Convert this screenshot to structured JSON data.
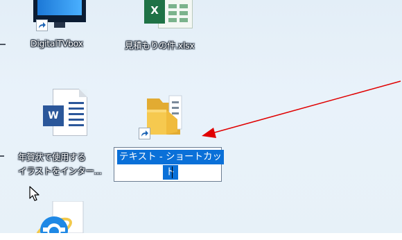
{
  "desktop": {
    "background_color": "#e7f1f8",
    "items": [
      {
        "label": "DigitalTVbox",
        "icon": "tv-icon",
        "shortcut": true
      },
      {
        "label": "見積もりの件.xlsx",
        "icon": "excel-icon",
        "shortcut": false
      },
      {
        "label_line1": "年賀状で使用する",
        "label_line2": "イラストをインター...",
        "icon": "word-doc-icon",
        "shortcut": false
      },
      {
        "icon": "folder-icon",
        "shortcut": true
      }
    ],
    "rename_box": {
      "line1": "テキスト - ショートカッ",
      "line2": "ト"
    },
    "bottom_icon": "internet-explorer-icon"
  },
  "annotation": {
    "arrow_color": "#e00000"
  },
  "colors": {
    "selection": "#0a70d8",
    "word": "#2b579a",
    "excel": "#1f7246",
    "folder": "#f6c94f"
  }
}
